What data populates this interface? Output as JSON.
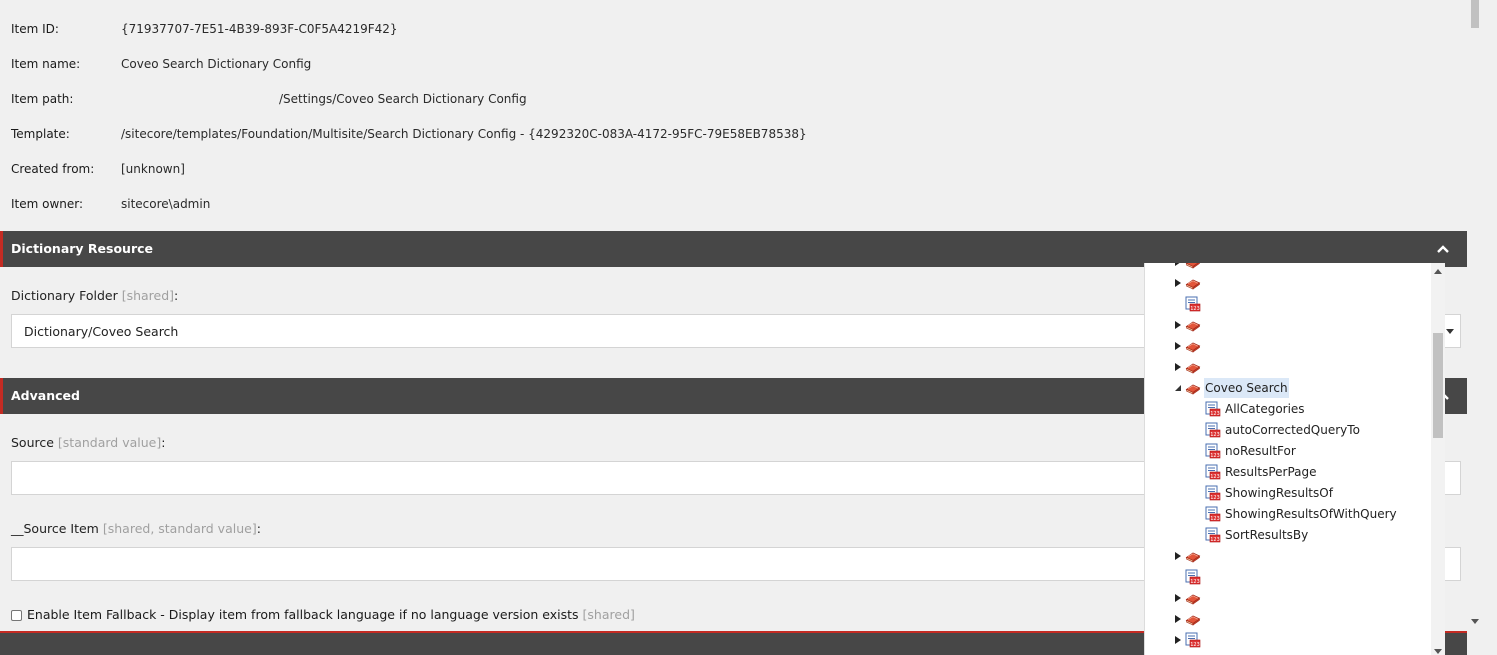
{
  "quick_info": {
    "rows": [
      {
        "label": "Item ID:",
        "value": "{71937707-7E51-4B39-893F-C0F5A4219F42}"
      },
      {
        "label": "Item name:",
        "value": "Coveo Search Dictionary Config"
      },
      {
        "label": "Item path:",
        "value": "/Settings/Coveo Search Dictionary Config"
      },
      {
        "label": "Template:",
        "value": "/sitecore/templates/Foundation/Multisite/Search Dictionary Config - {4292320C-083A-4172-95FC-79E58EB78538}"
      },
      {
        "label": "Created from:",
        "value": "[unknown]"
      },
      {
        "label": "Item owner:",
        "value": "sitecore\\admin"
      }
    ]
  },
  "sections": {
    "dictionary_resource": {
      "title": "Dictionary Resource",
      "field_label": "Dictionary Folder",
      "field_meta": "[shared]",
      "field_suffix": ":",
      "field_value": "Dictionary/Coveo Search"
    },
    "advanced": {
      "title": "Advanced",
      "source_label": "Source",
      "source_meta": "[standard value]",
      "source_suffix": ":",
      "source_item_label": "__Source Item",
      "source_item_meta": "[shared, standard value]",
      "source_item_suffix": ":",
      "fallback_label": "Enable Item Fallback - Display item from fallback language if no language version exists",
      "fallback_meta": "[shared]"
    }
  },
  "tree": {
    "selected_folder": "Coveo Search",
    "children": [
      "AllCategories",
      "autoCorrectedQueryTo",
      "noResultFor",
      "ResultsPerPage",
      "ShowingResultsOf",
      "ShowingResultsOfWithQuery",
      "SortResultsBy"
    ]
  },
  "icons": {
    "folder": "dictionary-folder-icon",
    "entry": "dictionary-entry-icon"
  },
  "colors": {
    "section_bar": "#474747",
    "accent": "#c42b23",
    "selection": "#dbe8f7"
  }
}
